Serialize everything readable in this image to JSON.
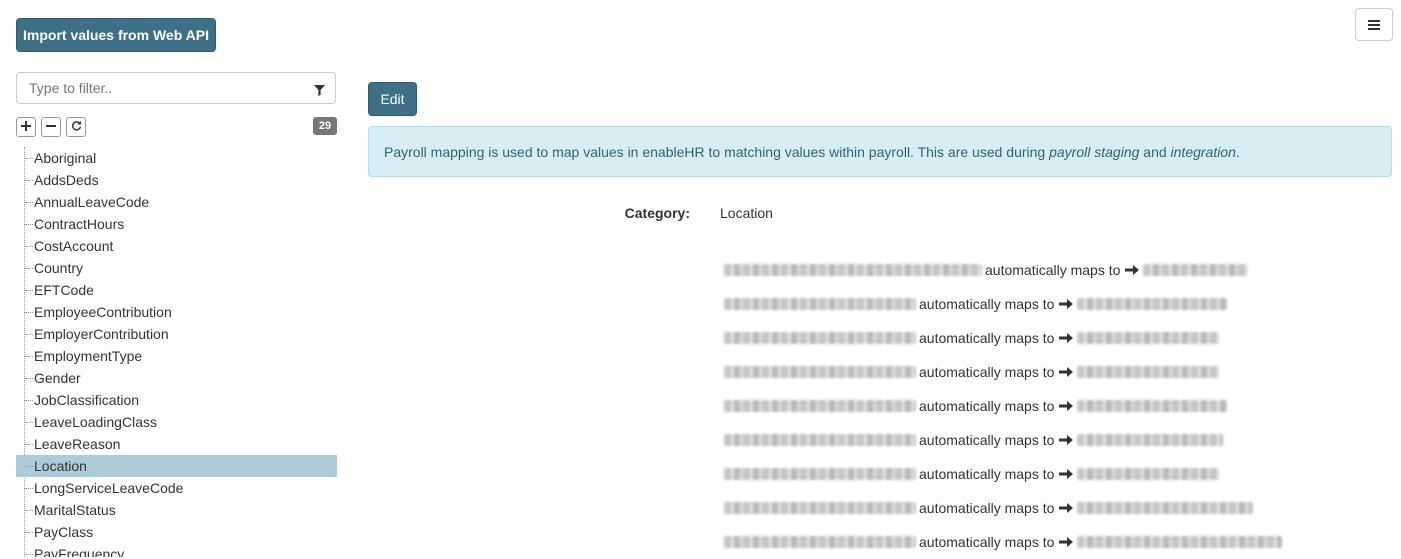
{
  "toolbar": {
    "import_label": "Import values from Web API",
    "edit_label": "Edit"
  },
  "icons": {
    "menu": "hamburger-menu-icon",
    "filter": "filter-funnel-icon",
    "expand": "plus-icon",
    "collapse": "minus-icon",
    "refresh": "refresh-icon",
    "arrow": "arrow-right-icon"
  },
  "colors": {
    "primary": "#3d6f86",
    "selected": "#adcbd8",
    "info_bg": "#d8edf4",
    "info_text": "#2f6476",
    "badge": "#777777"
  },
  "filter": {
    "placeholder": "Type to filter.."
  },
  "tree": {
    "count": "29",
    "items": [
      "Aboriginal",
      "AddsDeds",
      "AnnualLeaveCode",
      "ContractHours",
      "CostAccount",
      "Country",
      "EFTCode",
      "EmployeeContribution",
      "EmployerContribution",
      "EmploymentType",
      "Gender",
      "JobClassification",
      "LeaveLoadingClass",
      "LeaveReason",
      "Location",
      "LongServiceLeaveCode",
      "MaritalStatus",
      "PayClass",
      "PayFrequency"
    ],
    "selected": "Location"
  },
  "info": {
    "text_before": "Payroll mapping is used to map values in enableHR to matching values within payroll. This are used during ",
    "em1": "payroll staging",
    "text_mid": " and ",
    "em2": "integration",
    "text_after": "."
  },
  "detail": {
    "category_label": "Category:",
    "category_value": "Location",
    "mappings": [
      {
        "text": "automatically maps to"
      },
      {
        "text": "automatically maps to"
      },
      {
        "text": "automatically maps to"
      },
      {
        "text": "automatically maps to"
      },
      {
        "text": "automatically maps to"
      },
      {
        "text": "automatically maps to"
      },
      {
        "text": "automatically maps to"
      },
      {
        "text": "automatically maps to"
      },
      {
        "text": "automatically maps to"
      }
    ]
  }
}
